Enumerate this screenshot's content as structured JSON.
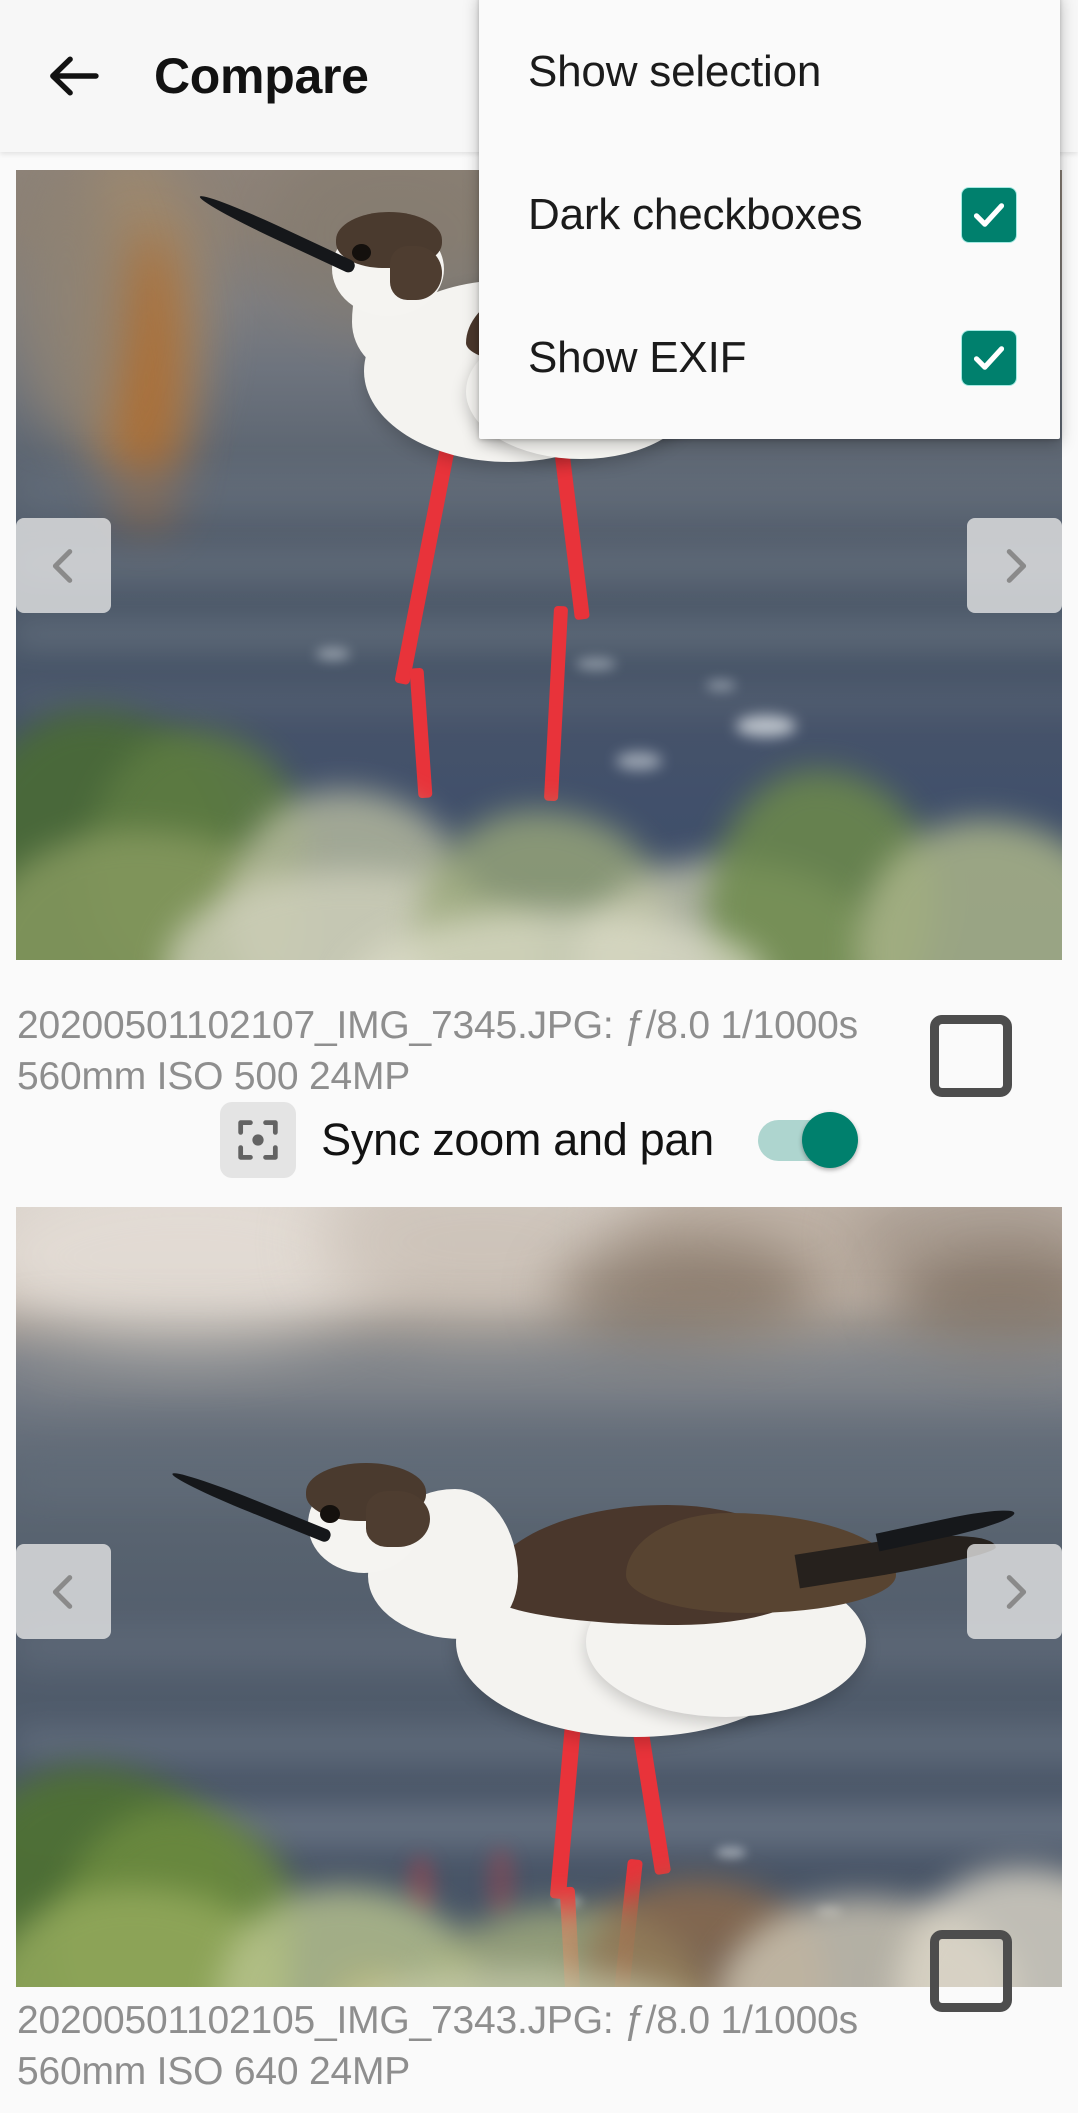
{
  "appbar": {
    "back_icon": "arrow-left-icon",
    "title": "Compare"
  },
  "overflow_menu": {
    "items": [
      {
        "label": "Show selection",
        "has_checkbox": false,
        "checked": false
      },
      {
        "label": "Dark checkboxes",
        "has_checkbox": true,
        "checked": true
      },
      {
        "label": "Show EXIF",
        "has_checkbox": true,
        "checked": true
      }
    ]
  },
  "panes": [
    {
      "id": "top",
      "subject": "black-winged stilt wading in water",
      "prev_icon": "chevron-left-icon",
      "next_icon": "chevron-right-icon",
      "selected": false,
      "exif": {
        "line1": "20200501102107_IMG_7345.JPG: ƒ/8.0 1/1000s",
        "line2": "560mm ISO 500 24MP",
        "filename": "20200501102107_IMG_7345.JPG",
        "aperture": "ƒ/8.0",
        "shutter": "1/1000s",
        "focal_length": "560mm",
        "iso": "ISO 500",
        "resolution": "24MP"
      }
    },
    {
      "id": "bottom",
      "subject": "black-winged stilt wading in water",
      "prev_icon": "chevron-left-icon",
      "next_icon": "chevron-right-icon",
      "selected": false,
      "exif": {
        "line1": "20200501102105_IMG_7343.JPG: ƒ/8.0 1/1000s",
        "line2": "560mm ISO 640 24MP",
        "filename": "20200501102105_IMG_7343.JPG",
        "aperture": "ƒ/8.0",
        "shutter": "1/1000s",
        "focal_length": "560mm",
        "iso": "ISO 640",
        "resolution": "24MP"
      }
    }
  ],
  "sync_row": {
    "icon": "center-focus-icon",
    "label": "Sync zoom and pan",
    "enabled": true
  },
  "colors": {
    "accent": "#00806d",
    "toggle_track": "#aed5cf",
    "appbar_bg": "#f7f7f7",
    "menu_bg": "#fafafa",
    "exif_text": "#8e8e8e",
    "checkbox_outline": "#4d4d4d"
  }
}
